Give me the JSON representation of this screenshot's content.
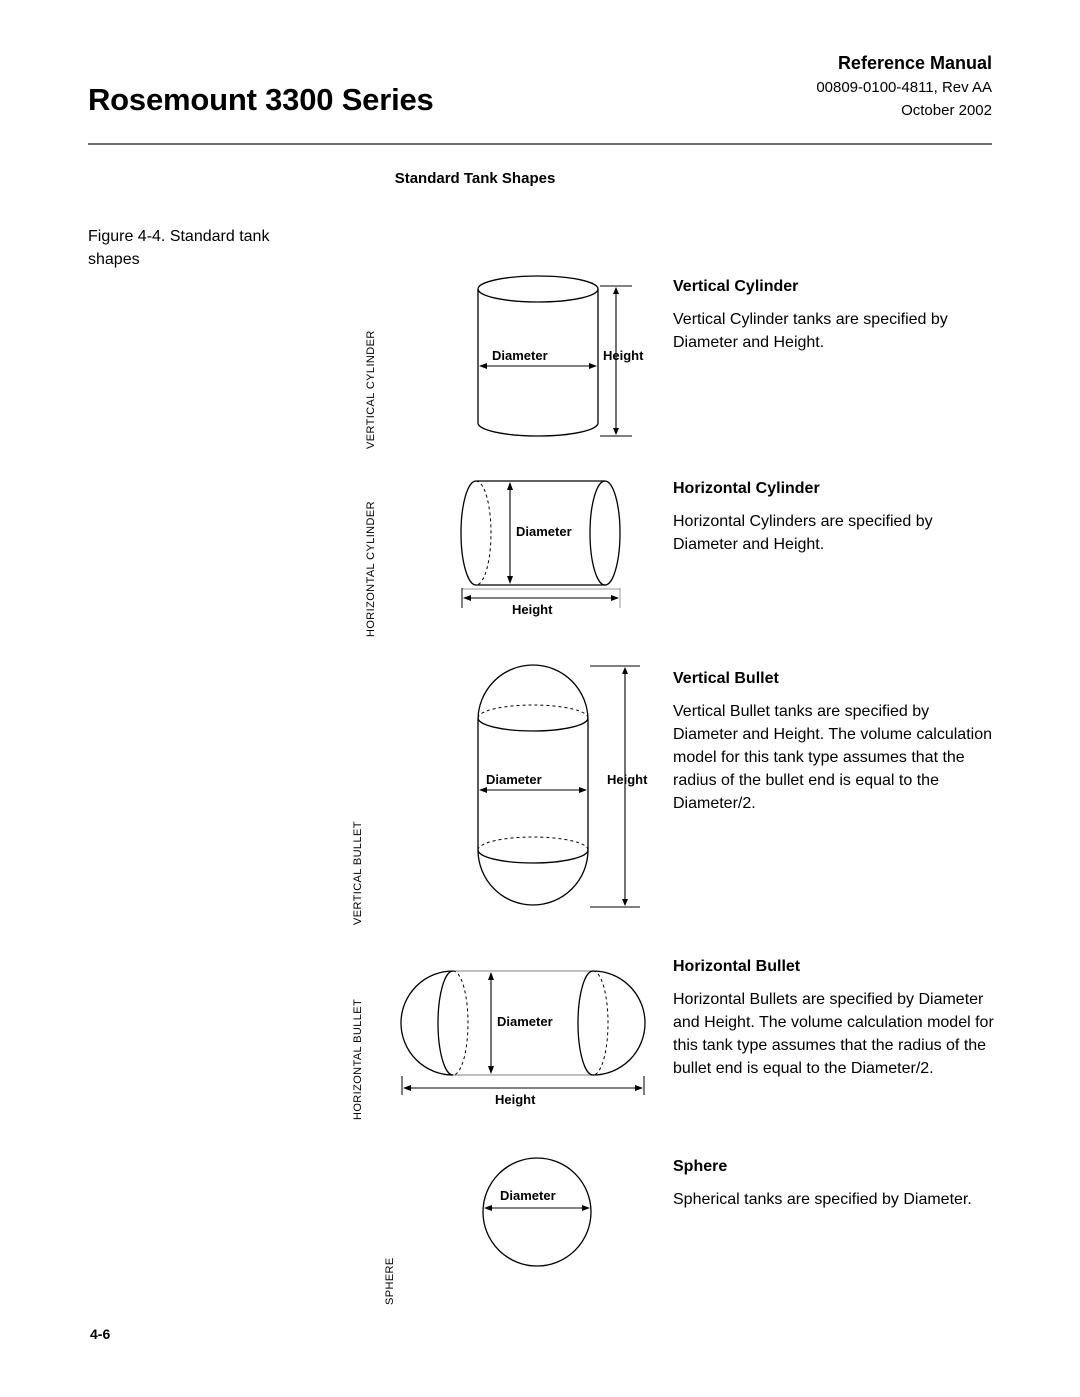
{
  "header": {
    "doc_title": "Rosemount 3300 Series",
    "manual_label": "Reference Manual",
    "doc_number": "00809-0100-4811, Rev AA",
    "doc_date": "October 2002"
  },
  "section": {
    "heading": "Standard Tank Shapes"
  },
  "figure": {
    "caption": "Figure 4-4. Standard tank shapes"
  },
  "labels": {
    "diameter": "Diameter",
    "height": "Height"
  },
  "categories": {
    "vertical_cylinder": "VERTICAL CYLINDER",
    "horizontal_cylinder": "HORIZONTAL CYLINDER",
    "vertical_bullet": "VERTICAL BULLET",
    "horizontal_bullet": "HORIZONTAL BULLET",
    "sphere": "SPHERE"
  },
  "shapes": [
    {
      "title": "Vertical Cylinder",
      "body": "Vertical Cylinder tanks are specified by Diameter and Height."
    },
    {
      "title": "Horizontal Cylinder",
      "body": "Horizontal Cylinders are specified by Diameter and Height."
    },
    {
      "title": "Vertical Bullet",
      "body": "Vertical Bullet tanks are specified by Diameter and Height. The volume calculation model for this tank type assumes that the radius of the bullet end is equal to the Diameter/2."
    },
    {
      "title": "Horizontal Bullet",
      "body": "Horizontal Bullets are specified by Diameter and Height. The volume calculation model for this tank type assumes that the radius of the bullet end is equal to the Diameter/2."
    },
    {
      "title": "Sphere",
      "body": "Spherical tanks are specified by Diameter."
    }
  ],
  "footer": {
    "page_number": "4-6"
  },
  "colors": {
    "rule": "#6b6f7a",
    "ink": "#000000",
    "page": "#ffffff"
  }
}
